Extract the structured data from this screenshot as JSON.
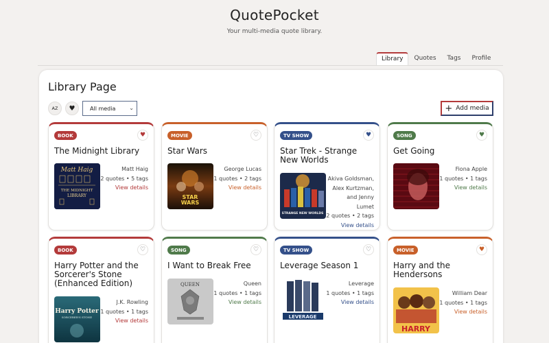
{
  "app": {
    "title": "QuotePocket",
    "subtitle": "Your multi-media quote library."
  },
  "tabs": [
    {
      "label": "Library",
      "active": true
    },
    {
      "label": "Quotes"
    },
    {
      "label": "Tags"
    },
    {
      "label": "Profile"
    }
  ],
  "page": {
    "title": "Library Page",
    "sort_icon_label": "AZ",
    "filter_value": "All media",
    "add_label": "Add media"
  },
  "colors": {
    "book": "#b33a3a",
    "movie": "#c8602a",
    "tv_show": "#34508a",
    "song": "#4f7a4a"
  },
  "cards": [
    {
      "type": "BOOK",
      "title": "The Midnight Library",
      "creator": "Matt Haig",
      "stats": "2 quotes • 5 tags",
      "link": "View details",
      "favorite": true,
      "cover_text": "Matt Haig\nTHE MIDNIGHT LIBRARY"
    },
    {
      "type": "MOVIE",
      "title": "Star Wars",
      "creator": "George Lucas",
      "stats": "1 quotes • 2 tags",
      "link": "View details",
      "favorite": false,
      "cover_text": "STAR WARS"
    },
    {
      "type": "TV SHOW",
      "title": "Star Trek - Strange New Worlds",
      "creator_lines": [
        "Akiva Goldsman,",
        "Alex Kurtzman,",
        "and Jenny",
        "Lumet"
      ],
      "stats": "2 quotes • 2 tags",
      "link": "View details",
      "favorite": true,
      "cover_text": "STRANGE NEW WORLDS"
    },
    {
      "type": "SONG",
      "title": "Get Going",
      "creator": "Fiona Apple",
      "stats": "1 quotes • 1 tags",
      "link": "View details",
      "favorite": true,
      "cover_text": ""
    },
    {
      "type": "BOOK",
      "title": "Harry Potter and the Sorcerer's Stone (Enhanced Edition)",
      "creator": "J.K. Rowling",
      "stats": "1 quotes • 1 tags",
      "link": "View details",
      "favorite": false,
      "cover_text": "Harry Potter"
    },
    {
      "type": "SONG",
      "title": "I Want to Break Free",
      "creator": "Queen",
      "stats": "1 quotes • 1 tags",
      "link": "View details",
      "favorite": false,
      "cover_text": "QUEEN"
    },
    {
      "type": "TV SHOW",
      "title": "Leverage Season 1",
      "creator": "Leverage",
      "stats": "1 quotes • 1 tags",
      "link": "View details",
      "favorite": false,
      "cover_text": "LEVERAGE"
    },
    {
      "type": "MOVIE",
      "title": "Harry and the Hendersons",
      "creator": "William Dear",
      "stats": "1 quotes • 1 tags",
      "link": "View details",
      "favorite": true,
      "cover_text": "HARRY"
    }
  ]
}
